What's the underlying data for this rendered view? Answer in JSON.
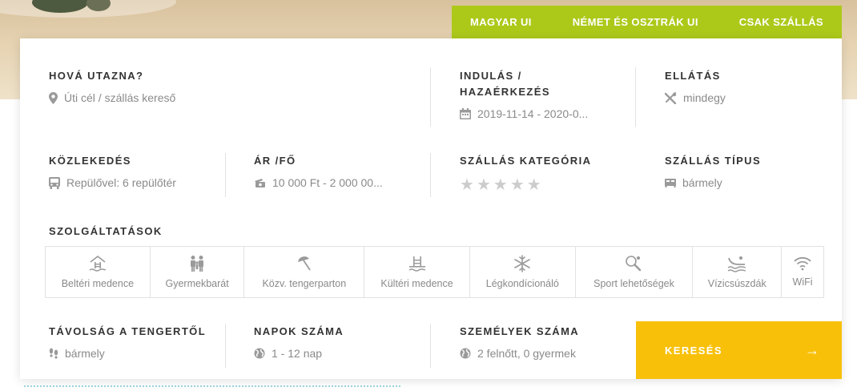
{
  "tabs": [
    "MAGYAR UI",
    "NÉMET ÉS OSZTRÁK UI",
    "CSAK SZÁLLÁS"
  ],
  "destination": {
    "label": "HOVÁ UTAZNA?",
    "placeholder": "Úti cél / szállás kereső",
    "icon": "map-pin-icon"
  },
  "dates": {
    "label_line1": "INDULÁS /",
    "label_line2": "HAZAÉRKEZÉS",
    "value": "2019-11-14 - 2020-0...",
    "icon": "calendar-icon"
  },
  "board": {
    "label": "ELLÁTÁS",
    "value": "mindegy",
    "icon": "cutlery-icon"
  },
  "transport": {
    "label": "KÖZLEKEDÉS",
    "value": "Repülővel: 6 repülőtér",
    "icon": "bus-icon"
  },
  "price": {
    "label": "ÁR /FŐ",
    "value": "10 000 Ft - 2 000 00...",
    "icon": "money-icon"
  },
  "category": {
    "label": "SZÁLLÁS KATEGÓRIA",
    "stars": 5,
    "selected": 0
  },
  "accommodation_type": {
    "label": "SZÁLLÁS TÍPUS",
    "value": "bármely",
    "icon": "bed-icon"
  },
  "services": {
    "label": "SZOLGÁLTATÁSOK",
    "items": [
      {
        "label": "Beltéri medence",
        "icon": "indoor-pool-icon"
      },
      {
        "label": "Gyermekbarát",
        "icon": "family-icon"
      },
      {
        "label": "Közv. tengerparton",
        "icon": "beach-umbrella-icon"
      },
      {
        "label": "Kültéri medence",
        "icon": "outdoor-pool-icon"
      },
      {
        "label": "Légkondícionáló",
        "icon": "snowflake-icon"
      },
      {
        "label": "Sport lehetőségek",
        "icon": "tennis-icon"
      },
      {
        "label": "Vízicsúszdák",
        "icon": "water-slide-icon"
      },
      {
        "label": "WiFi",
        "icon": "wifi-icon"
      }
    ]
  },
  "distance": {
    "label": "TÁVOLSÁG A TENGERTŐL",
    "value": "bármely",
    "icon": "footsteps-icon"
  },
  "days": {
    "label": "NAPOK SZÁMA",
    "value": "1 - 12 nap",
    "icon": "globe-icon"
  },
  "people": {
    "label": "SZEMÉLYEK SZÁMA",
    "value": "2 felnőtt, 0 gyermek",
    "icon": "globe-icon"
  },
  "search": {
    "label": "KERESÉS",
    "icon": "arrow-right-icon"
  },
  "colors": {
    "accent_green": "#acc91a",
    "search_yellow": "#f8c009",
    "text_gray": "#8a8a8a",
    "label_dark": "#333333"
  }
}
